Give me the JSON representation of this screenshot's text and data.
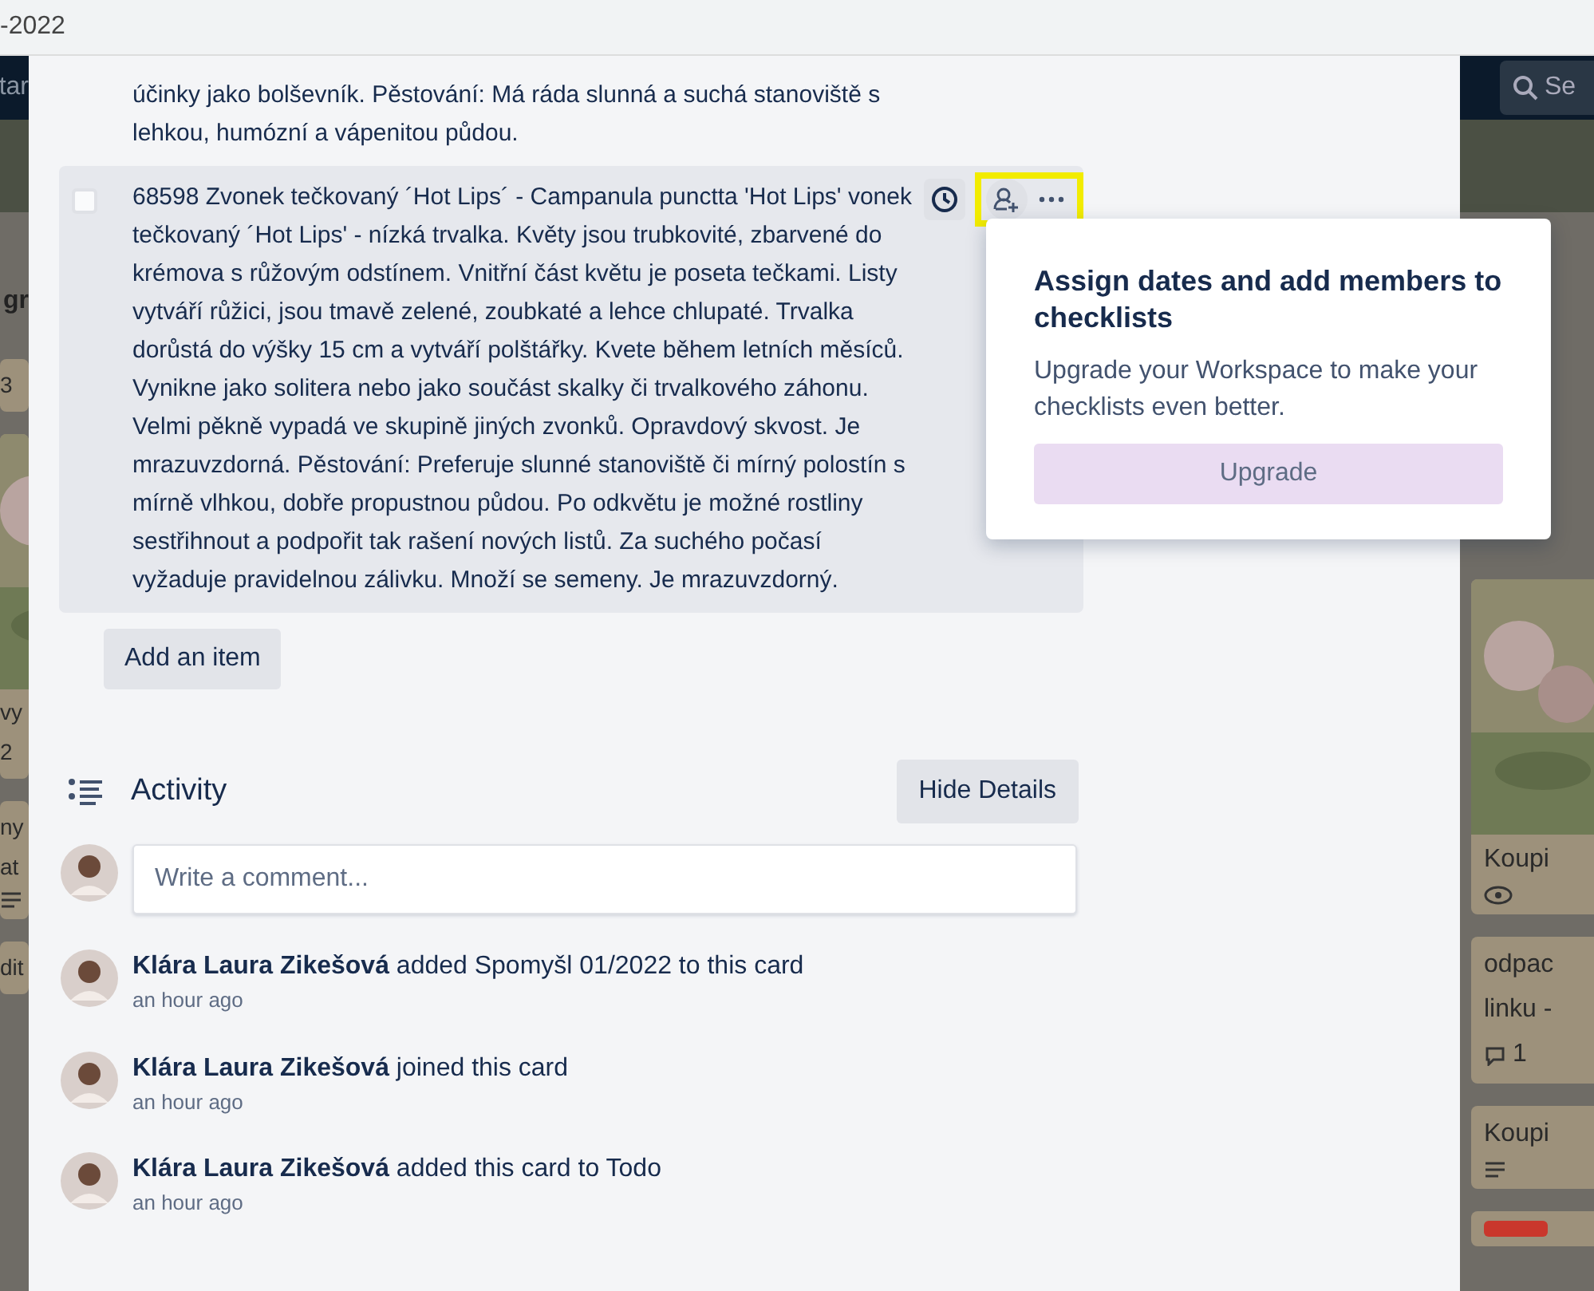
{
  "browser_bar": {
    "title": "-2022"
  },
  "board_left": {
    "nav_text": "tar",
    "list_title": "gr",
    "cards": [
      {
        "lines": [
          {
            "kind": "text",
            "text": "3"
          }
        ]
      },
      {
        "lines": [
          {
            "kind": "picture"
          },
          {
            "kind": "text",
            "text": "vy"
          },
          {
            "kind": "text",
            "text": "2"
          }
        ]
      },
      {
        "lines": [
          {
            "kind": "text",
            "text": "ny"
          },
          {
            "kind": "text",
            "text": "at"
          },
          {
            "kind": "description"
          }
        ]
      },
      {
        "lines": [
          {
            "kind": "text",
            "text": "dit"
          }
        ]
      }
    ]
  },
  "board_right": {
    "search": {
      "placeholder": "Se"
    },
    "cards": [
      {
        "lines": [
          {
            "kind": "picture"
          },
          {
            "kind": "text",
            "text": "Koupi"
          },
          {
            "kind": "watch"
          }
        ]
      },
      {
        "lines": [
          {
            "kind": "text",
            "text": "odpac"
          },
          {
            "kind": "text",
            "text": "linku -"
          },
          {
            "kind": "comments",
            "text": "1"
          }
        ]
      },
      {
        "lines": [
          {
            "kind": "text",
            "text": "Koupi"
          },
          {
            "kind": "description"
          }
        ]
      },
      {
        "lines": [
          {
            "kind": "label",
            "color": "#c9372c"
          }
        ]
      }
    ]
  },
  "checklist": {
    "items": [
      {
        "text": "účinky jako bolševník. Pěstování: Má ráda slunná a suchá stanoviště s lehkou, humózní a vápenitou půdou."
      },
      {
        "text": "68598 Zvonek tečkovaný ´Hot Lips´ - Campanula punctta 'Hot Lips' vonek tečkovaný ´Hot Lips' - nízká trvalka. Květy jsou trubkovité, zbarvené do krémova s růžovým odstínem. Vnitřní část květu je poseta tečkami. Listy vytváří růžici, jsou tmavě zelené, zoubkaté a lehce chlupaté. Trvalka dorůstá do výšky 15 cm a vytváří polštářky. Kvete během letních měsíců. Vynikne jako solitera nebo jako součást skalky či trvalkového záhonu. Velmi pěkně vypadá ve skupině jiných zvonků. Opravdový skvost. Je mrazuvzdorná. Pěstování: Preferuje slunné stanoviště či mírný polostín s mírně vlhkou, dobře propustnou půdou. Po odkvětu je možné rostliny sestřihnout a podpořit tak rašení nových listů. Za suchého počasí vyžaduje pravidelnou zálivku. Množí se semeny. Je mrazuvzdorný.",
        "checked": false,
        "selected": true,
        "actions": [
          {
            "kind": "due",
            "highlighted": false
          },
          {
            "kind": "member",
            "highlighted": true
          },
          {
            "kind": "more",
            "highlighted": true
          }
        ]
      }
    ],
    "add_button": "Add an item"
  },
  "popover": {
    "title": "Assign dates and add members to checklists",
    "text": "Upgrade your Workspace to make your checklists even better.",
    "button": "Upgrade"
  },
  "activity": {
    "title": "Activity",
    "toggle_button": "Hide Details",
    "comment": {
      "placeholder": "Write a comment..."
    },
    "entries": [
      {
        "author": "Klára Laura Zikešová",
        "action": "added Spomyšl 01/2022 to this card",
        "time": "an hour ago"
      },
      {
        "author": "Klára Laura Zikešová",
        "action": "joined this card",
        "time": "an hour ago"
      },
      {
        "author": "Klára Laura Zikešová",
        "action": "added this card to Todo",
        "time": "an hour ago"
      }
    ]
  }
}
